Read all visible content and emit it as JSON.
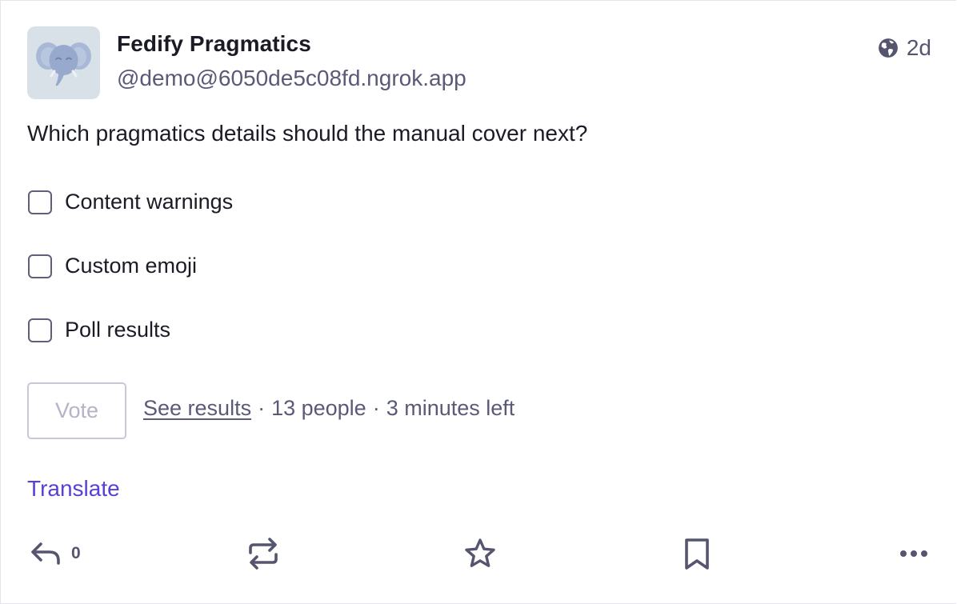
{
  "post": {
    "display_name": "Fedify Pragmatics",
    "handle": "@demo@6050de5c08fd.ngrok.app",
    "timestamp": "2d",
    "visibility_icon": "globe-icon",
    "avatar_icon": "elephant-mascot-icon",
    "content": "Which pragmatics details should the manual cover next?"
  },
  "poll": {
    "options": [
      {
        "label": "Content warnings",
        "checked": false
      },
      {
        "label": "Custom emoji",
        "checked": false
      },
      {
        "label": "Poll results",
        "checked": false
      }
    ],
    "vote_label": "Vote",
    "see_results_label": "See results",
    "voters": "13 people",
    "time_left": "3 minutes left",
    "separator": "·"
  },
  "translate_label": "Translate",
  "actions": {
    "reply_count": "0",
    "icons": [
      "reply-icon",
      "boost-icon",
      "favourite-icon",
      "bookmark-icon",
      "more-icon"
    ]
  },
  "colors": {
    "accent": "#5a3fd6",
    "text": "#1b1b26",
    "muted": "#5a5a78",
    "icon": "#555570",
    "avatar_bg": "#d9e1e8"
  }
}
